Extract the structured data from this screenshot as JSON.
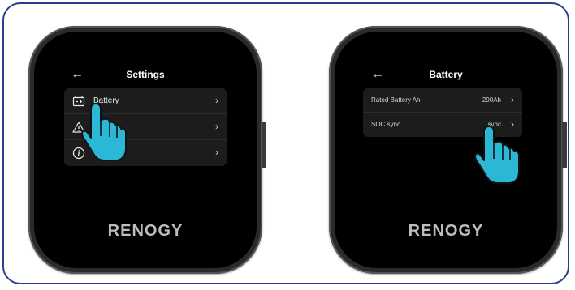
{
  "settings_screen": {
    "back_icon": "arrow-left",
    "title": "Settings",
    "items": [
      {
        "label": "Battery",
        "icon": "battery-icon"
      },
      {
        "label": "",
        "icon": "warning-icon"
      },
      {
        "label": "",
        "icon": "info-icon"
      }
    ],
    "brand": "RENOGY"
  },
  "battery_screen": {
    "back_icon": "arrow-left",
    "title": "Battery",
    "items": [
      {
        "label": "Rated Battery Ah",
        "value": "200Ah"
      },
      {
        "label": "SOC sync",
        "value": "sync"
      }
    ],
    "brand": "RENOGY"
  },
  "colors": {
    "frame": "#2b3e8c",
    "hand": "#2bb8d6"
  }
}
